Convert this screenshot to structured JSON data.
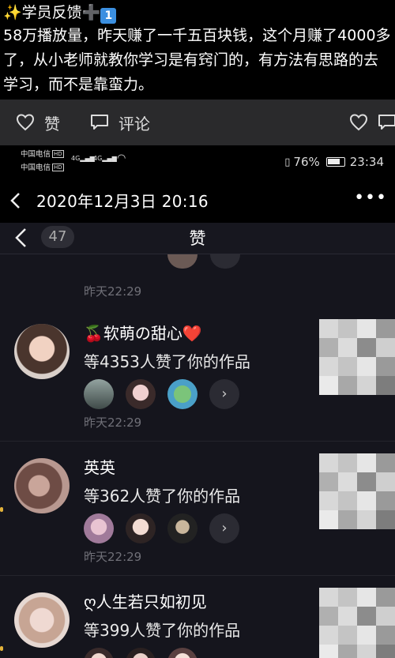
{
  "post": {
    "title_text": "学员反馈",
    "keycap": "1",
    "body": "58万播放量，昨天赚了一千五百块钱，这个月赚了4000多了，从小老师就教你学习是有窍门的，有方法有思路的去学习，而不是靠蛮力。"
  },
  "actions": {
    "like_label": "赞",
    "comment_label": "评论"
  },
  "status": {
    "carrier1": "中国电信",
    "carrier2": "中国电信",
    "hd": "HD",
    "net1": "4G",
    "net2": "4G",
    "battery": "76%",
    "time": "23:34"
  },
  "datebar": {
    "date": "2020年12月3日 20:16"
  },
  "likes": {
    "count": "47",
    "title": "赞",
    "prev_time": "昨天22:29",
    "items": [
      {
        "name": "🍒软萌の甜心❤️",
        "text": "等4353人赞了你的作品",
        "time": "昨天22:29"
      },
      {
        "name": "英英",
        "text": "等362人赞了你的作品",
        "time": "昨天22:29"
      },
      {
        "name": "ღ人生若只如初见",
        "text": "等399人赞了你的作品"
      }
    ]
  }
}
